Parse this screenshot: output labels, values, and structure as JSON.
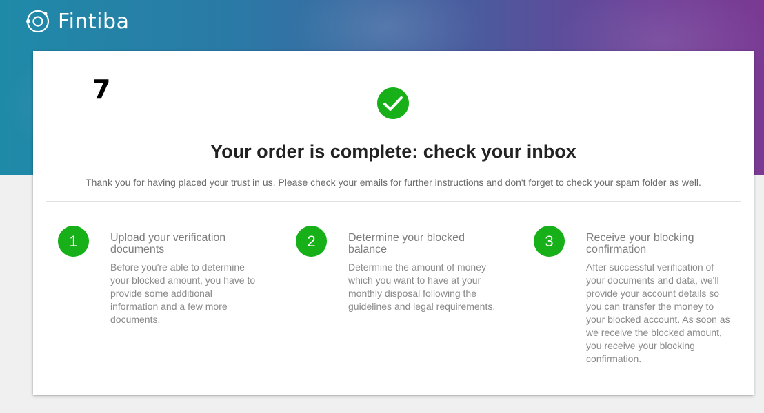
{
  "brand": {
    "name": "Fintiba",
    "logo_icon": "orbit-logo-icon"
  },
  "page": {
    "step_marker": "7",
    "success_icon": "checkmark-icon",
    "title": "Your order is complete: check your inbox",
    "subtitle": "Thank you for having placed your trust in us. Please check your emails for further instructions and don't forget to check your spam folder as well."
  },
  "steps": [
    {
      "number": "1",
      "heading": "Upload your verification documents",
      "text": "Before you're able to determine your blocked amount, you have to provide some additional information and a few more documents."
    },
    {
      "number": "2",
      "heading": "Determine your blocked balance",
      "text": "Determine the amount of money which you want to have at your monthly disposal following the guidelines and legal requirements."
    },
    {
      "number": "3",
      "heading": "Receive your blocking confirmation",
      "text": "After successful verification of your documents and data, we'll provide your account details so you can transfer the money to your blocked account. As soon as we receive the blocked amount, you receive your blocking confirmation."
    }
  ],
  "colors": {
    "accent_green": "#17b019",
    "hero_start": "#1f8aa8",
    "hero_end": "#7a3a94",
    "title_text": "#222222",
    "body_text": "#8a8a8a"
  }
}
